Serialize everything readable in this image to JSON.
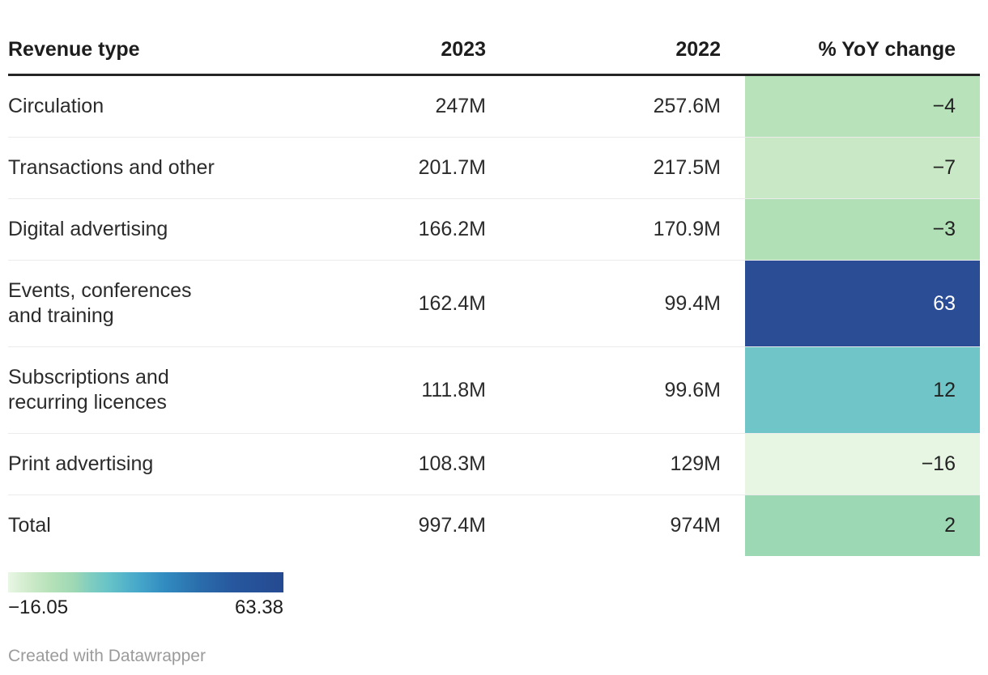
{
  "table": {
    "columns": [
      {
        "label": "Revenue type"
      },
      {
        "label": "2023"
      },
      {
        "label": "2022"
      },
      {
        "label": "% YoY change"
      }
    ],
    "rows": [
      {
        "revenue_type": "Circulation",
        "y2023": "247M",
        "y2022": "257.6M",
        "yoy": "−4",
        "yoy_bg": "#b7e2ba",
        "yoy_text_color": "#222222"
      },
      {
        "revenue_type": "Transactions and other",
        "y2023": "201.7M",
        "y2022": "217.5M",
        "yoy": "−7",
        "yoy_bg": "#c9e8c6",
        "yoy_text_color": "#222222"
      },
      {
        "revenue_type": "Digital advertising",
        "y2023": "166.2M",
        "y2022": "170.9M",
        "yoy": "−3",
        "yoy_bg": "#b2e0b6",
        "yoy_text_color": "#222222"
      },
      {
        "revenue_type": "Events, conferences\nand training",
        "y2023": "162.4M",
        "y2022": "99.4M",
        "yoy": "63",
        "yoy_bg": "#2a4d96",
        "yoy_text_color": "#ffffff"
      },
      {
        "revenue_type": "Subscriptions and\nrecurring licences",
        "y2023": "111.8M",
        "y2022": "99.6M",
        "yoy": "12",
        "yoy_bg": "#6fc5c7",
        "yoy_text_color": "#222222"
      },
      {
        "revenue_type": "Print advertising",
        "y2023": "108.3M",
        "y2022": "129M",
        "yoy": "−16",
        "yoy_bg": "#e7f6e3",
        "yoy_text_color": "#222222"
      },
      {
        "revenue_type": "Total",
        "y2023": "997.4M",
        "y2022": "974M",
        "yoy": "2",
        "yoy_bg": "#9cd8b4",
        "yoy_text_color": "#222222"
      }
    ]
  },
  "legend": {
    "min_label": "−16.05",
    "max_label": "63.38",
    "gradient_colors": [
      "#e9f6e4",
      "#9dd8b4",
      "#65c2c8",
      "#318bc0",
      "#254a91"
    ]
  },
  "footer": {
    "credit": "Created with Datawrapper"
  },
  "chart_data": {
    "type": "table",
    "title": "",
    "columns": [
      "Revenue type",
      "2023",
      "2022",
      "% YoY change"
    ],
    "rows": [
      {
        "revenue_type": "Circulation",
        "v2023": 247,
        "v2022": 257.6,
        "yoy_change_pct": -4
      },
      {
        "revenue_type": "Transactions and other",
        "v2023": 201.7,
        "v2022": 217.5,
        "yoy_change_pct": -7
      },
      {
        "revenue_type": "Digital advertising",
        "v2023": 166.2,
        "v2022": 170.9,
        "yoy_change_pct": -3
      },
      {
        "revenue_type": "Events, conferences and training",
        "v2023": 162.4,
        "v2022": 99.4,
        "yoy_change_pct": 63
      },
      {
        "revenue_type": "Subscriptions and recurring licences",
        "v2023": 111.8,
        "v2022": 99.6,
        "yoy_change_pct": 12
      },
      {
        "revenue_type": "Print advertising",
        "v2023": 108.3,
        "v2022": 129,
        "yoy_change_pct": -16
      },
      {
        "revenue_type": "Total",
        "v2023": 997.4,
        "v2022": 974,
        "yoy_change_pct": 2
      }
    ],
    "value_unit": "M",
    "heatmap_column": "% YoY change",
    "color_scale": {
      "min": -16.05,
      "max": 63.38,
      "colors": [
        "#e9f6e4",
        "#9dd8b4",
        "#65c2c8",
        "#318bc0",
        "#254a91"
      ],
      "legend_position": "bottom-left"
    }
  }
}
